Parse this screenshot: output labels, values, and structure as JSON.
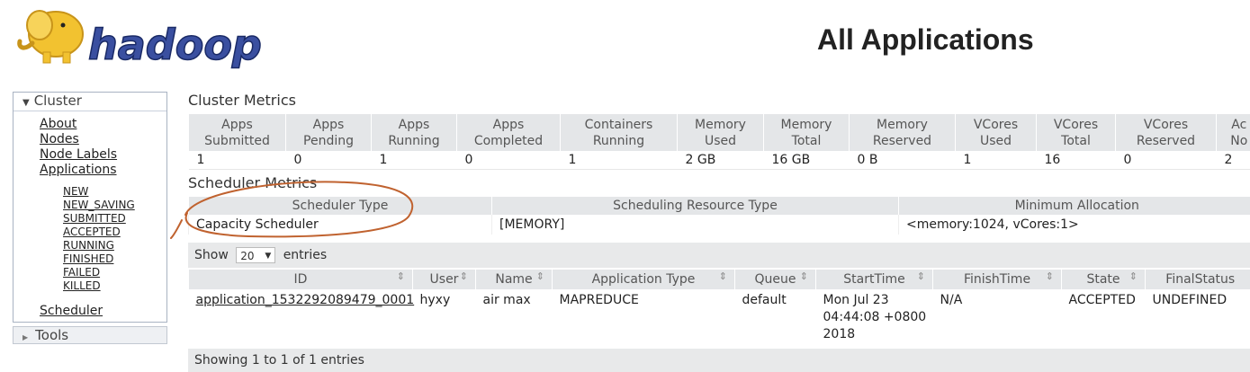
{
  "header": {
    "logo_text": "hadoop",
    "title": "All Applications"
  },
  "sidebar": {
    "cluster_label": "Cluster",
    "links": [
      "About",
      "Nodes",
      "Node Labels",
      "Applications"
    ],
    "app_states": [
      "NEW",
      "NEW_SAVING",
      "SUBMITTED",
      "ACCEPTED",
      "RUNNING",
      "FINISHED",
      "FAILED",
      "KILLED"
    ],
    "scheduler_label": "Scheduler",
    "tools_label": "Tools"
  },
  "cluster_metrics": {
    "title": "Cluster Metrics",
    "headers": [
      [
        "Apps",
        "Submitted"
      ],
      [
        "Apps",
        "Pending"
      ],
      [
        "Apps",
        "Running"
      ],
      [
        "Apps",
        "Completed"
      ],
      [
        "Containers",
        "Running"
      ],
      [
        "Memory",
        "Used"
      ],
      [
        "Memory",
        "Total"
      ],
      [
        "Memory",
        "Reserved"
      ],
      [
        "VCores",
        "Used"
      ],
      [
        "VCores",
        "Total"
      ],
      [
        "VCores",
        "Reserved"
      ],
      [
        "Ac",
        "No"
      ]
    ],
    "values": [
      "1",
      "0",
      "1",
      "0",
      "1",
      "2 GB",
      "16 GB",
      "0 B",
      "1",
      "16",
      "0",
      "2"
    ]
  },
  "scheduler_metrics": {
    "title": "Scheduler Metrics",
    "headers": [
      "Scheduler Type",
      "Scheduling Resource Type",
      "Minimum Allocation"
    ],
    "values": [
      "Capacity Scheduler",
      "[MEMORY]",
      "<memory:1024, vCores:1>"
    ]
  },
  "entries_control": {
    "show_label": "Show",
    "page_size": "20",
    "entries_label": "entries"
  },
  "applications_table": {
    "headers": [
      "ID",
      "User",
      "Name",
      "Application Type",
      "Queue",
      "StartTime",
      "FinishTime",
      "State",
      "FinalStatus"
    ],
    "rows": [
      {
        "id": "application_1532292089479_0001",
        "user": "hyxy",
        "name": "air max",
        "type": "MAPREDUCE",
        "queue": "default",
        "start_line1": "Mon Jul 23",
        "start_line2": "04:44:08 +0800",
        "start_line3": "2018",
        "finish": "N/A",
        "state": "ACCEPTED",
        "final_status": "UNDEFINED"
      }
    ]
  },
  "footer": {
    "showing": "Showing 1 to 1 of 1 entries"
  },
  "colors": {
    "header_bg": "#e4e6e8",
    "annotation": "#c0622f",
    "logo_fill": "#3a4fa0",
    "elephant": "#f2c230"
  }
}
